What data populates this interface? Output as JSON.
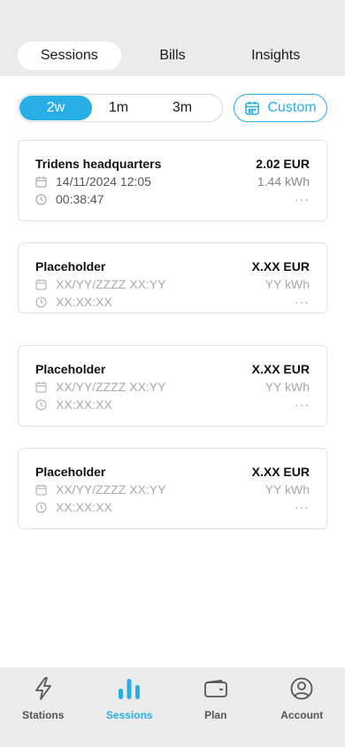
{
  "tabs": [
    {
      "label": "Sessions",
      "active": true
    },
    {
      "label": "Bills",
      "active": false
    },
    {
      "label": "Insights",
      "active": false
    }
  ],
  "range": {
    "options": [
      "2w",
      "1m",
      "3m"
    ],
    "selected": "2w",
    "custom_label": "Custom"
  },
  "sessions": [
    {
      "location": "Tridens headquarters",
      "datetime": "14/11/2024 12:05",
      "duration": "00:38:47",
      "amount": "2.02 EUR",
      "energy": "1.44 kWh",
      "more": "···"
    },
    {
      "location": "Placeholder",
      "datetime": "XX/YY/ZZZZ XX:YY",
      "duration": "XX:XX:XX",
      "amount": "X.XX EUR",
      "energy": "YY kWh",
      "more": "···"
    },
    {
      "location": "Placeholder",
      "datetime": "XX/YY/ZZZZ XX:YY",
      "duration": "XX:XX:XX",
      "amount": "X.XX EUR",
      "energy": "YY kWh",
      "more": "···"
    },
    {
      "location": "Placeholder",
      "datetime": "XX/YY/ZZZZ XX:YY",
      "duration": "XX:XX:XX",
      "amount": "X.XX EUR",
      "energy": "YY kWh",
      "more": "···"
    }
  ],
  "nav": [
    {
      "label": "Stations",
      "icon": "lightning-icon",
      "active": false
    },
    {
      "label": "Sessions",
      "icon": "bar-chart-icon",
      "active": true
    },
    {
      "label": "Plan",
      "icon": "wallet-icon",
      "active": false
    },
    {
      "label": "Account",
      "icon": "user-circle-icon",
      "active": false
    }
  ],
  "colors": {
    "accent": "#27aee4",
    "nav_bg": "#ebebeb",
    "placeholder_text": "#a8a8a8"
  }
}
